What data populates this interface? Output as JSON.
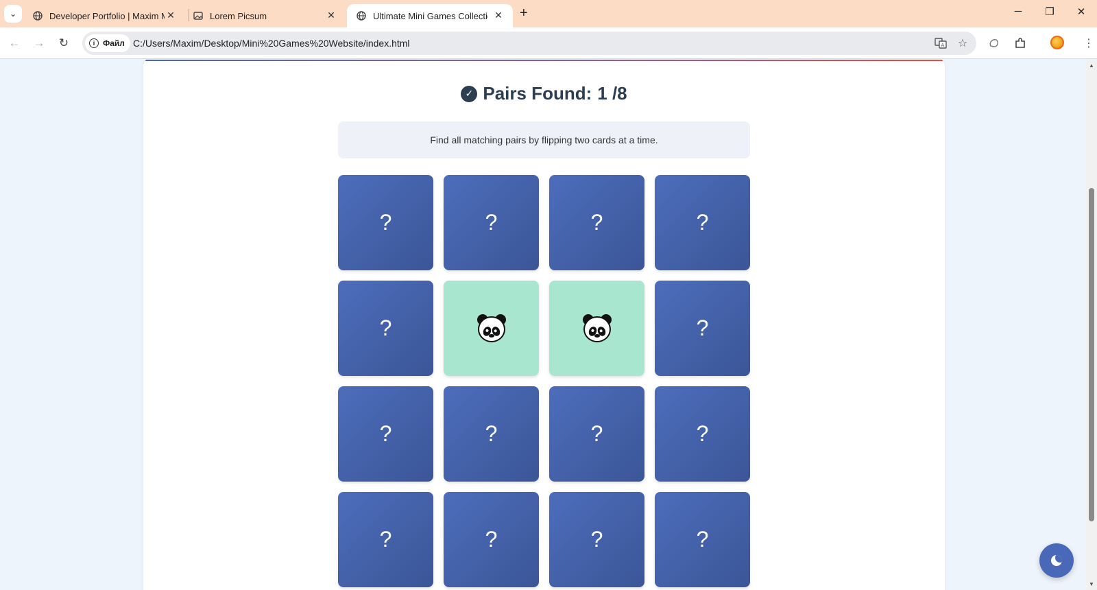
{
  "browser": {
    "tabs": [
      {
        "title": "Developer Portfolio | Maxim Mk",
        "active": false,
        "favicon": "globe-icon"
      },
      {
        "title": "Lorem Picsum",
        "active": false,
        "favicon": "image-icon"
      },
      {
        "title": "Ultimate Mini Games Collection",
        "active": true,
        "favicon": "globe-icon"
      }
    ],
    "site_info_label": "Файл",
    "url": "C:/Users/Maxim/Desktop/Mini%20Games%20Website/index.html"
  },
  "game": {
    "pairs_label": "Pairs Found:",
    "pairs_found": "1 /8",
    "instructions": "Find all matching pairs by flipping two cards at a time.",
    "hidden_symbol": "?",
    "cards": [
      {
        "state": "hidden"
      },
      {
        "state": "hidden"
      },
      {
        "state": "hidden"
      },
      {
        "state": "hidden"
      },
      {
        "state": "hidden"
      },
      {
        "state": "matched",
        "icon": "panda-icon"
      },
      {
        "state": "matched",
        "icon": "panda-icon"
      },
      {
        "state": "hidden"
      },
      {
        "state": "hidden"
      },
      {
        "state": "hidden"
      },
      {
        "state": "hidden"
      },
      {
        "state": "hidden"
      },
      {
        "state": "hidden"
      },
      {
        "state": "hidden"
      },
      {
        "state": "hidden"
      },
      {
        "state": "hidden"
      }
    ]
  },
  "colors": {
    "card_hidden": "#4d6dbc",
    "card_matched": "#a9e6cf",
    "accent_gradient_end": "#e74c3c",
    "theme_button": "#4a68b8"
  },
  "theme_toggle": {
    "icon": "moon-icon"
  }
}
